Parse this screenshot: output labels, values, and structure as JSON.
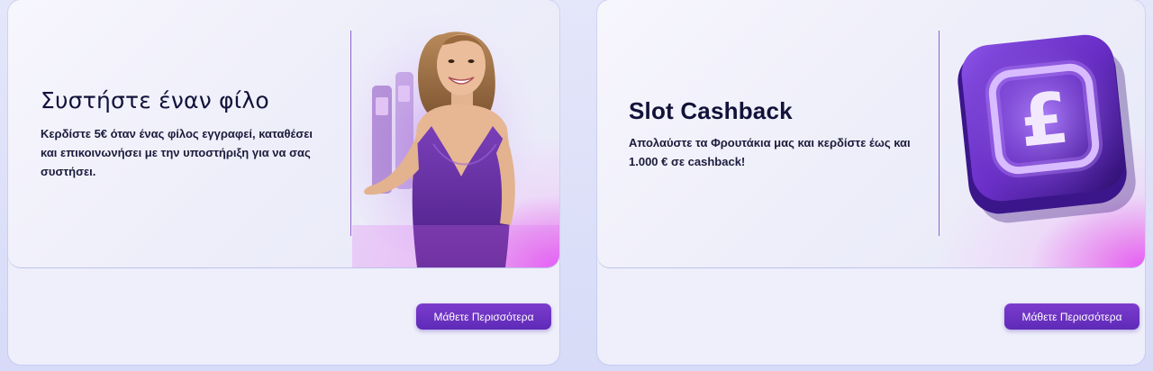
{
  "cards": [
    {
      "title": "Συστήστε έναν φίλο",
      "description": "Κερδίστε 5€ όταν ένας φίλος εγγραφεί, καταθέσει και επικοινωνήσει με την υποστήριξη για να σας συστήσει.",
      "button_label": "Μάθετε Περισσότερα",
      "image": "smiling-woman-purple-dress-casino"
    },
    {
      "title": "Slot Cashback",
      "description": "Απολαύστε τα Φρουτάκια μας και κερδίστε έως και 1.000 € σε cashback!",
      "button_label": "Μάθετε Περισσότερα",
      "image": "pound-coin-icon"
    }
  ],
  "colors": {
    "button": "#6a32c2",
    "title": "#12123a",
    "accent": "#e65bf5"
  }
}
